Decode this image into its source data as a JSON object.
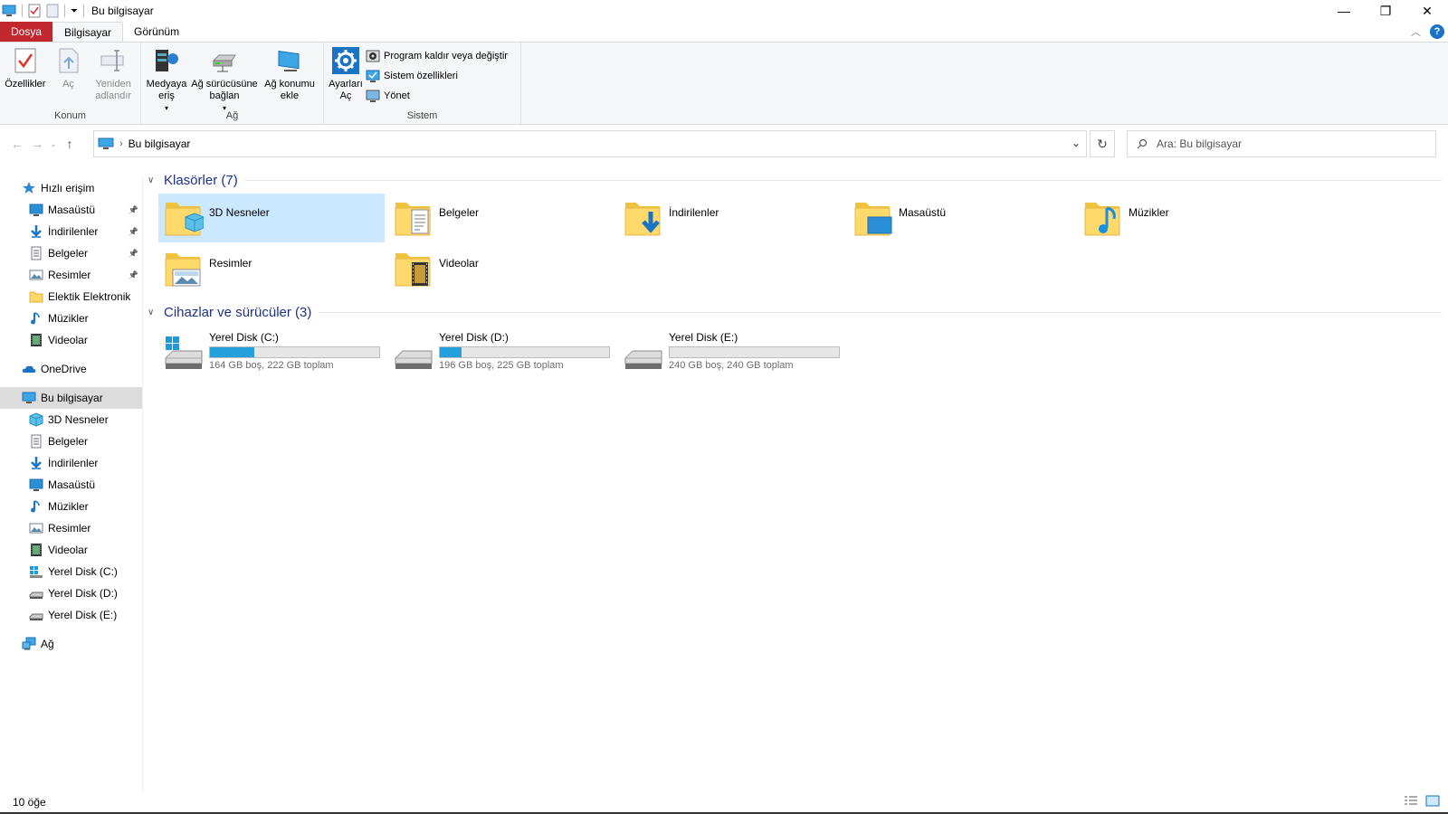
{
  "window": {
    "title": "Bu bilgisayar"
  },
  "ribbon_tabs": {
    "file": "Dosya",
    "computer": "Bilgisayar",
    "view": "Görünüm"
  },
  "ribbon": {
    "location": {
      "label": "Konum",
      "properties": "Özellikler",
      "open": "Aç",
      "rename": "Yeniden adlandır"
    },
    "network": {
      "label": "Ağ",
      "media_access": "Medyaya eriş",
      "map_drive": "Ağ sürücüsüne bağlan",
      "add_location": "Ağ konumu ekle"
    },
    "system": {
      "label": "Sistem",
      "open_settings": "Ayarları Aç",
      "uninstall": "Program kaldır veya değiştir",
      "system_properties": "Sistem özellikleri",
      "manage": "Yönet"
    }
  },
  "address": {
    "path": "Bu bilgisayar",
    "search_placeholder": "Ara: Bu bilgisayar"
  },
  "nav": {
    "quick_access": "Hızlı erişim",
    "quick_items": [
      {
        "label": "Masaüstü",
        "icon": "desktop-icon",
        "pinned": true
      },
      {
        "label": "İndirilenler",
        "icon": "download-icon",
        "pinned": true
      },
      {
        "label": "Belgeler",
        "icon": "documents-icon",
        "pinned": true
      },
      {
        "label": "Resimler",
        "icon": "pictures-icon",
        "pinned": true
      },
      {
        "label": "Elektik Elektronik",
        "icon": "folder-icon",
        "pinned": false
      },
      {
        "label": "Müzikler",
        "icon": "music-icon",
        "pinned": false
      },
      {
        "label": "Videolar",
        "icon": "videos-icon",
        "pinned": false
      }
    ],
    "onedrive": "OneDrive",
    "this_pc": "Bu bilgisayar",
    "pc_items": [
      {
        "label": "3D Nesneler",
        "icon": "3d-objects-icon"
      },
      {
        "label": "Belgeler",
        "icon": "documents-icon"
      },
      {
        "label": "İndirilenler",
        "icon": "download-icon"
      },
      {
        "label": "Masaüstü",
        "icon": "desktop-icon"
      },
      {
        "label": "Müzikler",
        "icon": "music-icon"
      },
      {
        "label": "Resimler",
        "icon": "pictures-icon"
      },
      {
        "label": "Videolar",
        "icon": "videos-icon"
      },
      {
        "label": "Yerel Disk (C:)",
        "icon": "windows-drive-icon"
      },
      {
        "label": "Yerel Disk (D:)",
        "icon": "drive-icon"
      },
      {
        "label": "Yerel Disk (E:)",
        "icon": "drive-icon"
      }
    ],
    "network": "Ağ"
  },
  "content": {
    "folders_header": "Klasörler (7)",
    "folders": [
      {
        "label": "3D Nesneler",
        "icon": "3d-objects-folder-icon",
        "selected": true
      },
      {
        "label": "Belgeler",
        "icon": "documents-folder-icon",
        "selected": false
      },
      {
        "label": "İndirilenler",
        "icon": "downloads-folder-icon",
        "selected": false
      },
      {
        "label": "Masaüstü",
        "icon": "desktop-folder-icon",
        "selected": false
      },
      {
        "label": "Müzikler",
        "icon": "music-folder-icon",
        "selected": false
      },
      {
        "label": "Resimler",
        "icon": "pictures-folder-icon",
        "selected": false
      },
      {
        "label": "Videolar",
        "icon": "videos-folder-icon",
        "selected": false
      }
    ],
    "drives_header": "Cihazlar ve sürücüler (3)",
    "drives": [
      {
        "label": "Yerel Disk (C:)",
        "size_text": "164 GB boş, 222 GB toplam",
        "used_fraction": 0.26,
        "icon": "windows-drive-icon"
      },
      {
        "label": "Yerel Disk (D:)",
        "size_text": "196 GB boş, 225 GB toplam",
        "used_fraction": 0.13,
        "icon": "drive-icon"
      },
      {
        "label": "Yerel Disk (E:)",
        "size_text": "240 GB boş, 240 GB toplam",
        "used_fraction": 0.0,
        "icon": "drive-icon"
      }
    ]
  },
  "status": {
    "item_count": "10 öğe"
  },
  "colors": {
    "accent": "#26a0da",
    "file_tab": "#c1272d",
    "section_header": "#1e3287",
    "selection": "#cce8ff"
  }
}
